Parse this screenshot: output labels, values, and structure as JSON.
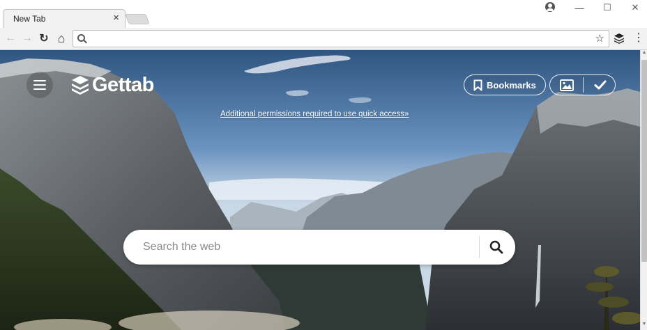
{
  "browser": {
    "tab_title": "New Tab",
    "tab_close": "×",
    "address_value": "",
    "window_controls": {
      "minimize": "—",
      "maximize": "☐",
      "close": "✕"
    },
    "nav": {
      "back": "←",
      "forward": "→",
      "reload": "↻",
      "home": "⌂"
    },
    "star": "☆",
    "menu": "⋮"
  },
  "gettab": {
    "logo_text": "Gettab",
    "bookmarks_label": "Bookmarks",
    "permissions_link": "Additional permissions required to use quick access»",
    "search_placeholder": "Search the web"
  },
  "icons": {
    "menu": "hamburger-icon",
    "logo": "layers-icon",
    "bookmark": "bookmark-icon",
    "image": "image-icon",
    "check": "check-icon",
    "search": "search-icon"
  },
  "colors": {
    "sky_top": "#3a5f8a",
    "overlay_text": "#ffffff",
    "search_bg": "#ffffff"
  }
}
